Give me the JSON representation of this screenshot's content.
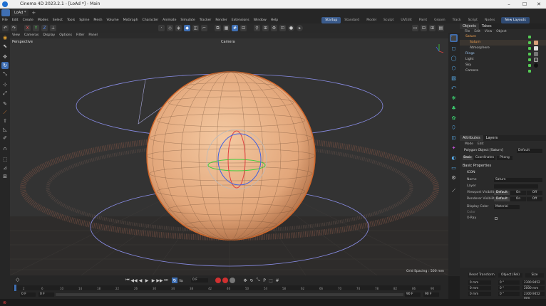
{
  "window": {
    "title": "Cinema 4D 2023.2.1 - [LoAd *] - Main",
    "controls": [
      "–",
      "☐",
      "✕"
    ]
  },
  "tabs": {
    "items": [
      "LoAd *"
    ],
    "new_tab": "+"
  },
  "menubar": {
    "items": [
      "File",
      "Edit",
      "Create",
      "Modes",
      "Select",
      "Tools",
      "Spline",
      "Mesh",
      "Volume",
      "MoGraph",
      "Character",
      "Animate",
      "Simulate",
      "Tracker",
      "Render",
      "Extensions",
      "Window",
      "Help"
    ],
    "layouts": [
      "Startup",
      "Standard",
      "Model",
      "Sculpt",
      "UVEdit",
      "Paint",
      "Groom",
      "Track",
      "Script",
      "Nodes"
    ],
    "active_layout": "Startup",
    "new_layouts": "New Layouts"
  },
  "viewport": {
    "menu": [
      "View",
      "Cameras",
      "Display",
      "Options",
      "Filter",
      "Panel"
    ],
    "label": "Perspective",
    "camera": "Camera",
    "grid_spacing": "Grid Spacing : 500 mm"
  },
  "objects_panel": {
    "tabs": [
      "Objects",
      "Takes"
    ],
    "menu": [
      "File",
      "Edit",
      "View",
      "Object"
    ],
    "items": [
      {
        "name": "Saturn",
        "color": "#e07a2a",
        "selected": true
      },
      {
        "name": "Saturn",
        "color": "#e07a2a",
        "selected": true
      },
      {
        "name": "Atmosphere",
        "color": "#cccccc",
        "selected": false
      },
      {
        "name": "Rings",
        "color": "#7ab0e0",
        "selected": false
      },
      {
        "name": "Light",
        "color": "#cccccc",
        "selected": false
      },
      {
        "name": "Sky",
        "color": "#cccccc",
        "selected": false
      },
      {
        "name": "Camera",
        "color": "#cccccc",
        "selected": false
      }
    ]
  },
  "attributes": {
    "tabs": [
      "Attributes",
      "Layers"
    ],
    "menu": [
      "Mode",
      "Edit"
    ],
    "object_type": "Polygon Object [Saturn]",
    "preset": "Default",
    "subtabs": [
      "Basic",
      "Coordinates",
      "Phong"
    ],
    "section": "Basic Properties",
    "subsection": "ICON",
    "fields": {
      "name_label": "Name",
      "name_value": "Saturn",
      "layer_label": "Layer",
      "viewport_vis_label": "Viewport Visibility",
      "render_vis_label": "Renderer Visibility",
      "vis_options": [
        "Default",
        "On",
        "Off"
      ],
      "display_color_label": "Display Color",
      "display_color_value": "Material",
      "color_label": "Color",
      "xray_label": "X-Ray"
    }
  },
  "timeline": {
    "current_frame": "0 F",
    "start": "0 F",
    "preview_start": "0 F",
    "preview_end": "90 F",
    "end": "90 F",
    "ticks": [
      "0",
      "2",
      "4",
      "6",
      "8",
      "10",
      "12",
      "14",
      "16",
      "18",
      "20",
      "22",
      "24",
      "26",
      "28",
      "30",
      "32",
      "34",
      "36",
      "38",
      "40",
      "42",
      "44",
      "46",
      "48",
      "50",
      "52",
      "54",
      "56",
      "58",
      "60",
      "62",
      "64",
      "66",
      "68",
      "70",
      "72",
      "74",
      "76",
      "78",
      "80",
      "82",
      "84",
      "86",
      "88",
      "90"
    ]
  },
  "coords": {
    "buttons": [
      "Reset Transform",
      "Object (Rel)",
      "Size"
    ],
    "rows": [
      [
        "0 mm",
        "0 °",
        "2300.9452 mm"
      ],
      [
        "0 mm",
        "0 °",
        "2000 mm"
      ],
      [
        "0 mm",
        "0 °",
        "2300.9452 mm"
      ]
    ]
  },
  "colors": {
    "accent": "#3f6fb3",
    "planet": "#e8b48a",
    "orbit": "#8a8ee8"
  }
}
